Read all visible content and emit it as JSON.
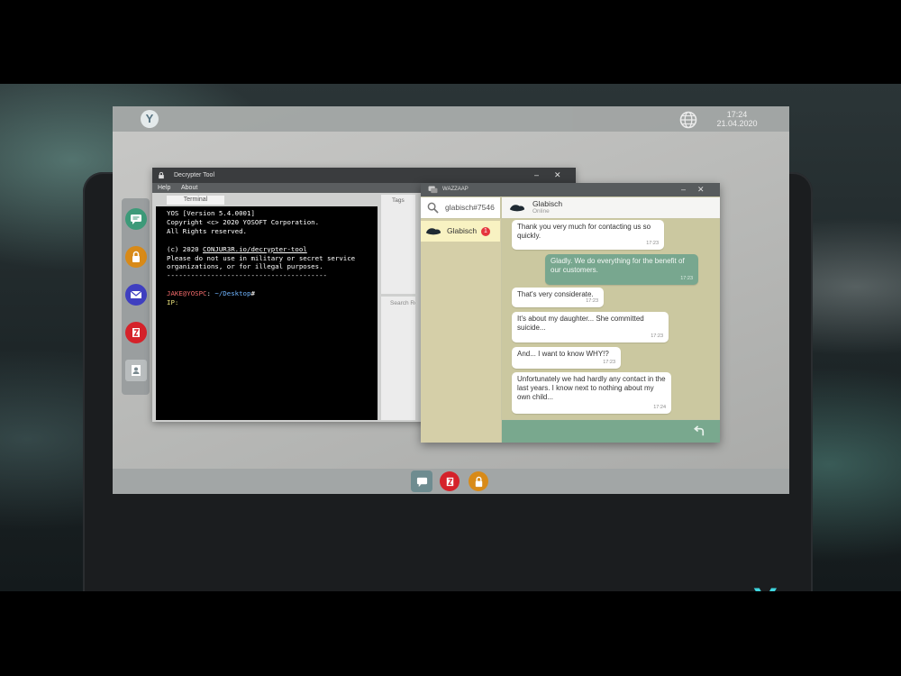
{
  "os": {
    "clock_time": "17:24",
    "clock_date": "21.04.2020",
    "logo_glyph": "Y"
  },
  "decrypter": {
    "title": "Decrypter Tool",
    "menu": [
      "Help",
      "About"
    ],
    "terminal_tab": "Terminal",
    "tags_label": "Tags",
    "search_placeholder": "Search Re",
    "terminal": {
      "line1": "YOS [Version 5.4.0001]",
      "line2": "Copyright <c> 2020 YOSOFT Corporation.",
      "line3": "All Rights reserved.",
      "line4_prefix": "(c) 2020 ",
      "line4_link": "CONJUR3R.io/decrypter-tool",
      "line5": "Please do not use in military or secret service",
      "line6": "organizations, or for illegal purposes.",
      "separator": "----------------------------------------",
      "prompt_user": "JAKE@YOSPC",
      "prompt_sep": ": ",
      "prompt_path": "~/Desktop",
      "prompt_end": "#",
      "ip_label": "IP:"
    }
  },
  "chat": {
    "app_title": "WAZZAAP",
    "search_value": "glabisch#7546",
    "contact_name": "Glabisch",
    "contact_badge": "1",
    "header_name": "Glabisch",
    "header_status": "Online",
    "messages": [
      {
        "dir": "in",
        "text": "Thank you very much for contacting us so quickly.",
        "time": "17:23"
      },
      {
        "dir": "out",
        "text": "Gladly. We do everything for the benefit of our customers.",
        "time": "17:23"
      },
      {
        "dir": "in",
        "text": "That's very considerate.",
        "time": "17:23"
      },
      {
        "dir": "in",
        "text": "It's about my daughter... She committed suicide...",
        "time": "17:23"
      },
      {
        "dir": "in",
        "text": "And... I want to know WHY!?",
        "time": "17:23"
      },
      {
        "dir": "in",
        "text": "Unfortunately we had hardly any contact in the last years. I know next to nothing about my own child...",
        "time": "17:24"
      }
    ]
  },
  "colors": {
    "accent_teal": "#78a78f",
    "brand_cyan": "#3fd6df",
    "badge_red": "#e5343e"
  },
  "icons": [
    "globe-icon",
    "chat-icon",
    "lock-icon",
    "mail-icon",
    "decrypter-icon",
    "contacts-icon",
    "search-icon",
    "send-icon",
    "minimize-icon",
    "close-icon"
  ]
}
